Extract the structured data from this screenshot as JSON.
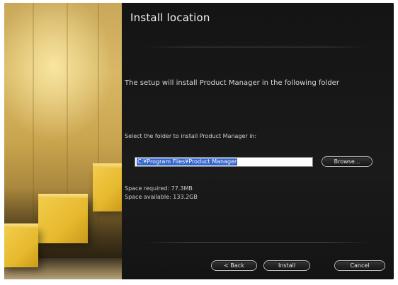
{
  "window": {
    "title": "Install location"
  },
  "main": {
    "intro_text": "The setup will install Product Manager in the following folder",
    "folder_label": "Select the folder to install Product Manager in:",
    "path_value": "C:¥Program Files¥Product Manager",
    "browse_label": "Browse...",
    "space_required": "Space required: 77.3MB",
    "space_available": "Space available: 133.2GB"
  },
  "footer": {
    "back_label": "< Back",
    "install_label": "Install",
    "cancel_label": "Cancel"
  },
  "colors": {
    "panel_bg": "#161616",
    "accent_selection": "#3366cc",
    "cube_yellow": "#e6b92e"
  },
  "icons": [
    "decorative-cubes-image"
  ]
}
